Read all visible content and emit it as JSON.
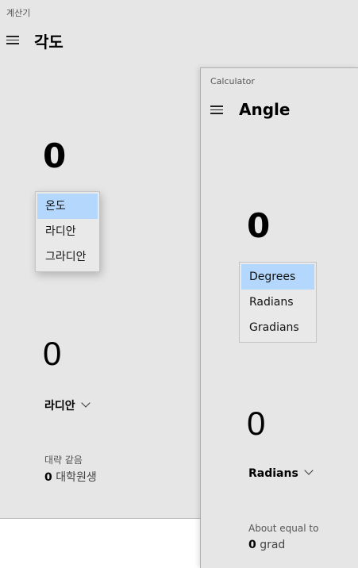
{
  "korean_window": {
    "app_title": "계산기",
    "mode_title": "각도",
    "input_value": "0",
    "dropdown_options": [
      {
        "label": "온도",
        "selected": true
      },
      {
        "label": "라디안",
        "selected": false
      },
      {
        "label": "그라디안",
        "selected": false
      }
    ],
    "output_value": "0",
    "output_unit": "라디안",
    "approx_label": "대략 같음",
    "approx_value": "0",
    "approx_unit": "대학원생"
  },
  "english_window": {
    "app_title": "Calculator",
    "mode_title": "Angle",
    "input_value": "0",
    "dropdown_options": [
      {
        "label": "Degrees",
        "selected": true
      },
      {
        "label": "Radians",
        "selected": false
      },
      {
        "label": "Gradians",
        "selected": false
      }
    ],
    "output_value": "0",
    "output_unit": "Radians",
    "approx_label": "About equal to",
    "approx_value": "0",
    "approx_unit": "grad"
  },
  "icons": {
    "menu": "hamburger-menu-icon",
    "dropdown": "chevron-down-icon"
  },
  "colors": {
    "window_bg": "#e6e6e6",
    "selected_option": "#b4d8fd"
  }
}
